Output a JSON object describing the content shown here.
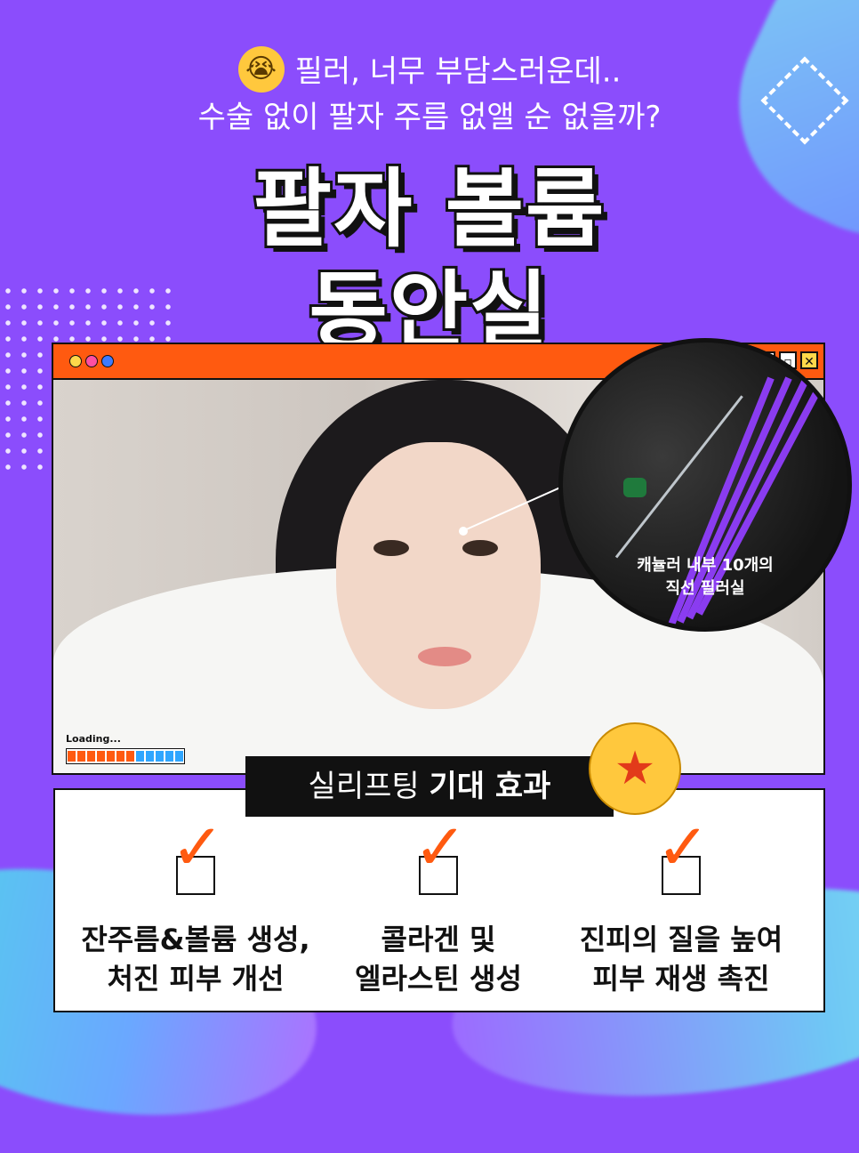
{
  "intro": {
    "emoji": "crying-face",
    "line1": "필러, 너무 부담스러운데..",
    "line2": "수술 없이 팔자 주름 없앨 순 없을까?"
  },
  "headline": {
    "line1": "팔자 볼륨",
    "line2": "동안실"
  },
  "window": {
    "loading_label": "Loading...",
    "loading_progress": 0.55,
    "inset_label_line1": "캐뉼러 내부 10개의",
    "inset_label_line2": "직선 필러실",
    "buttons": [
      "minimize",
      "maximize",
      "close"
    ]
  },
  "effects": {
    "title_light": "실리프팅 ",
    "title_bold": "기대 효과",
    "items": [
      {
        "line1": "잔주름&볼륨 생성,",
        "line2": "처진 피부 개선"
      },
      {
        "line1": "콜라겐 및",
        "line2": "엘라스틴 생성"
      },
      {
        "line1": "진피의 질을 높여",
        "line2": "피부 재생 촉진"
      }
    ]
  },
  "colors": {
    "background": "#8b4dfc",
    "titlebar": "#ff5a10",
    "strand": "#8a3cf0",
    "check": "#ff5a10"
  }
}
